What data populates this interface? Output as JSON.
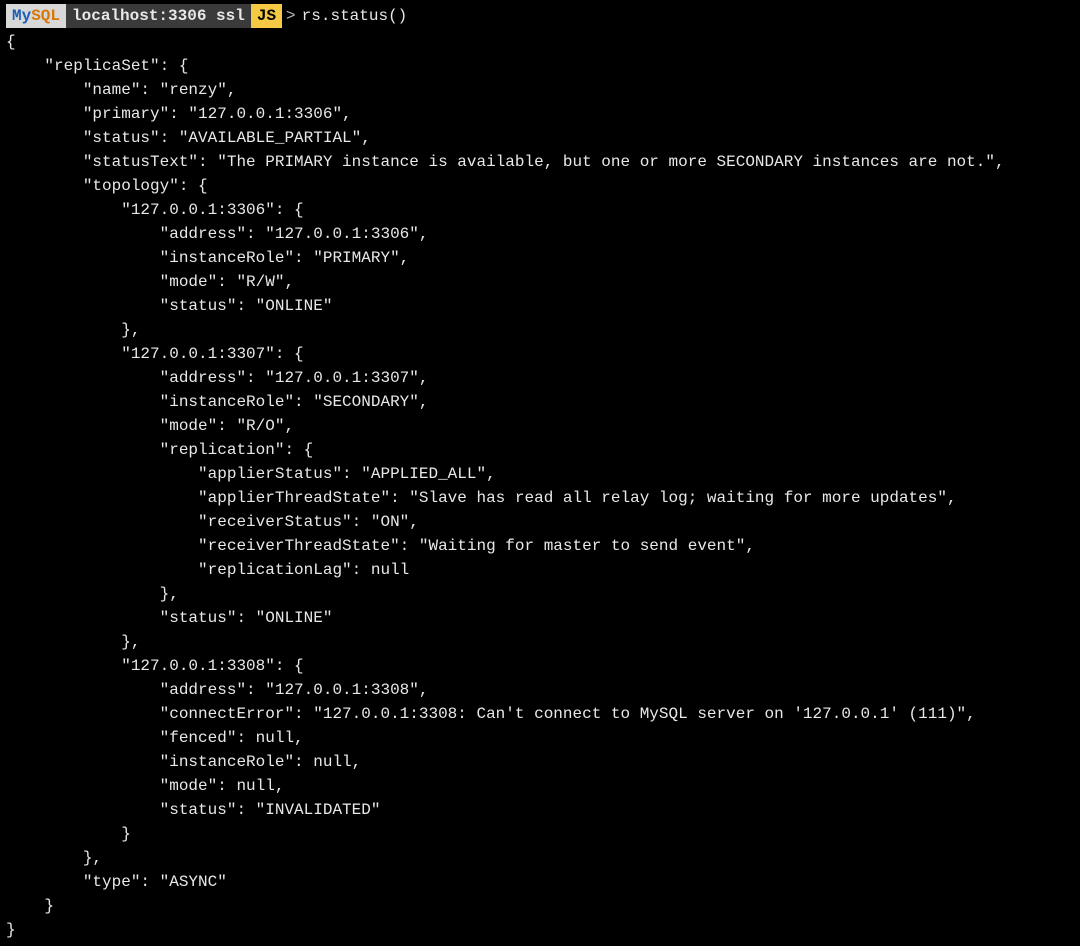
{
  "prompt": {
    "mysql_label_my": "My",
    "mysql_label_sql": "SQL",
    "host": "localhost:3306 ssl",
    "mode": "JS",
    "arrow": ">",
    "command": "rs.status()"
  },
  "output": "{\n    \"replicaSet\": {\n        \"name\": \"renzy\",\n        \"primary\": \"127.0.0.1:3306\",\n        \"status\": \"AVAILABLE_PARTIAL\",\n        \"statusText\": \"The PRIMARY instance is available, but one or more SECONDARY instances are not.\",\n        \"topology\": {\n            \"127.0.0.1:3306\": {\n                \"address\": \"127.0.0.1:3306\",\n                \"instanceRole\": \"PRIMARY\",\n                \"mode\": \"R/W\",\n                \"status\": \"ONLINE\"\n            },\n            \"127.0.0.1:3307\": {\n                \"address\": \"127.0.0.1:3307\",\n                \"instanceRole\": \"SECONDARY\",\n                \"mode\": \"R/O\",\n                \"replication\": {\n                    \"applierStatus\": \"APPLIED_ALL\",\n                    \"applierThreadState\": \"Slave has read all relay log; waiting for more updates\",\n                    \"receiverStatus\": \"ON\",\n                    \"receiverThreadState\": \"Waiting for master to send event\",\n                    \"replicationLag\": null\n                },\n                \"status\": \"ONLINE\"\n            },\n            \"127.0.0.1:3308\": {\n                \"address\": \"127.0.0.1:3308\",\n                \"connectError\": \"127.0.0.1:3308: Can't connect to MySQL server on '127.0.0.1' (111)\",\n                \"fenced\": null,\n                \"instanceRole\": null,\n                \"mode\": null,\n                \"status\": \"INVALIDATED\"\n            }\n        },\n        \"type\": \"ASYNC\"\n    }\n}"
}
